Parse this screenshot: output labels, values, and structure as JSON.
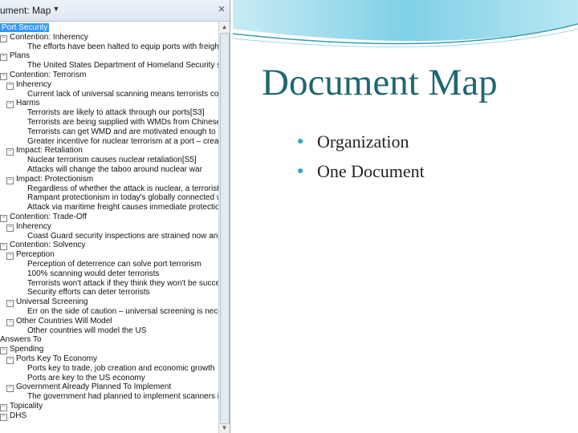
{
  "slide": {
    "title": "Document Map",
    "bullets": [
      "Organization",
      "One Document"
    ],
    "accent_color": "#2aa9c2",
    "title_color": "#1e6670"
  },
  "pane": {
    "title": "ument: Map",
    "dropdown_icon": "chevron-down-icon",
    "close_icon": "close-icon",
    "close_glyph": "×"
  },
  "tree": [
    {
      "label": "Port Security",
      "toggle": "",
      "selected": true
    },
    {
      "label": "Contention: Inherency",
      "toggle": "−"
    },
    {
      "label": "The efforts have been halted to equip ports with freight scanners",
      "toggle": ""
    },
    {
      "label": "Plans",
      "toggle": "−"
    },
    {
      "label": "The United States Department of Homeland Security should",
      "toggle": ""
    },
    {
      "label": "Contention: Terrorism",
      "toggle": "−"
    },
    {
      "label": "Inherency",
      "toggle": "−"
    },
    {
      "label": "Current lack of universal scanning means terrorists could",
      "toggle": ""
    },
    {
      "label": "Harms",
      "toggle": "−"
    },
    {
      "label": "Terrorists are likely to attack through our ports[S3]",
      "toggle": ""
    },
    {
      "label": "Terrorists are being supplied with WMDs from Chinese co",
      "toggle": ""
    },
    {
      "label": "Terrorists can get WMD and are motivated enough to use",
      "toggle": ""
    },
    {
      "label": "Greater incentive for nuclear terrorism at a port – creat",
      "toggle": ""
    },
    {
      "label": "Impact: Retaliation",
      "toggle": "−"
    },
    {
      "label": "Nuclear terrorism causes nuclear retaliation[S5]",
      "toggle": ""
    },
    {
      "label": "Attacks will change the taboo around nuclear war",
      "toggle": ""
    },
    {
      "label": "Impact: Protectionism",
      "toggle": "−"
    },
    {
      "label": "Regardless of whether the attack is nuclear, a terrorist a",
      "toggle": ""
    },
    {
      "label": "Rampant protectionism in today's globally connected wo",
      "toggle": ""
    },
    {
      "label": "Attack via maritime freight causes immediate protection",
      "toggle": ""
    },
    {
      "label": "Contention: Trade-Off",
      "toggle": "−"
    },
    {
      "label": "Inherency",
      "toggle": "−"
    },
    {
      "label": "Coast Guard security inspections are strained now and",
      "toggle": ""
    },
    {
      "label": "Contention: Solvency",
      "toggle": "−"
    },
    {
      "label": "Perception",
      "toggle": "−"
    },
    {
      "label": "Perception of deterrence can solve port terrorism",
      "toggle": ""
    },
    {
      "label": "100% scanning would deter terrorists",
      "toggle": ""
    },
    {
      "label": "Terrorists won't attack if they think they won't be succe",
      "toggle": ""
    },
    {
      "label": "Security efforts can deter terrorists",
      "toggle": ""
    },
    {
      "label": "Universal Screening",
      "toggle": "−"
    },
    {
      "label": "Err on the side of caution – universal screening is neces",
      "toggle": ""
    },
    {
      "label": "Other Countries Will Model",
      "toggle": "−"
    },
    {
      "label": "Other countries will model the US",
      "toggle": ""
    },
    {
      "label": "Answers To",
      "toggle": ""
    },
    {
      "label": "Spending",
      "toggle": "−"
    },
    {
      "label": "Ports Key To Economy",
      "toggle": "−"
    },
    {
      "label": "Ports key to trade, job creation and economic growth",
      "toggle": ""
    },
    {
      "label": "Ports are key to the US economy",
      "toggle": ""
    },
    {
      "label": "Government Already Planned To Implement",
      "toggle": "−"
    },
    {
      "label": "The government had planned to implement scanners in",
      "toggle": ""
    },
    {
      "label": "Topicality",
      "toggle": "−"
    },
    {
      "label": "DHS",
      "toggle": "−"
    }
  ]
}
